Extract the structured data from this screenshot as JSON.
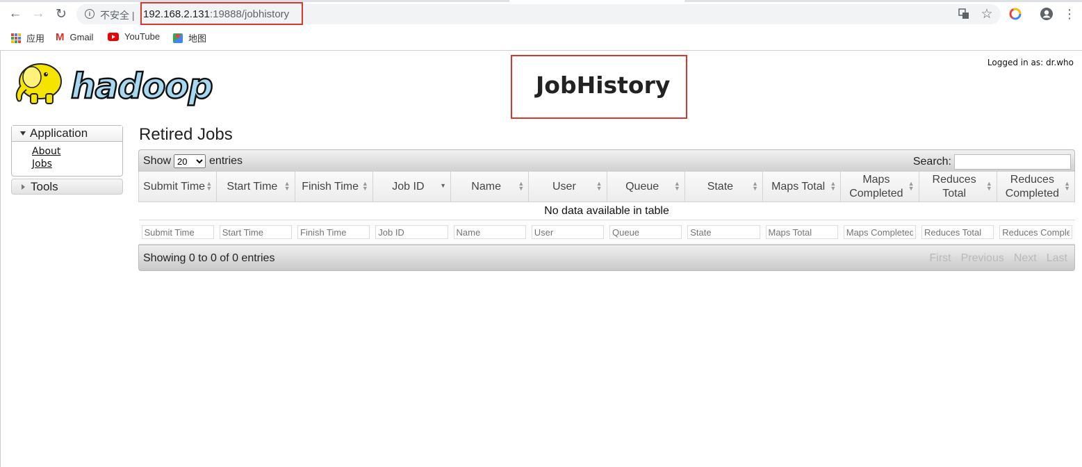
{
  "browser": {
    "insecure_label": "不安全 |",
    "url_host": "192.168.2.131",
    "url_path": ":19888/jobhistory",
    "bookmarks": [
      {
        "label": "应用",
        "icon": "apps-grid-icon"
      },
      {
        "label": "Gmail",
        "icon": "gmail-icon"
      },
      {
        "label": "YouTube",
        "icon": "youtube-icon"
      },
      {
        "label": "地图",
        "icon": "maps-icon"
      }
    ],
    "annotation_color": "#d9372d"
  },
  "header": {
    "logo_text": "hadoop",
    "title": "JobHistory",
    "logged_in": "Logged in as: dr.who"
  },
  "sidebar": {
    "application": {
      "label": "Application",
      "links": [
        "About",
        "Jobs"
      ]
    },
    "tools_label": "Tools"
  },
  "main": {
    "section_title": "Retired Jobs",
    "show_label": "Show",
    "entries_value": "20",
    "entries_label": "entries",
    "search_label": "Search:",
    "columns": [
      {
        "line1": "Submit Time",
        "line2": ""
      },
      {
        "line1": "Start Time",
        "line2": ""
      },
      {
        "line1": "Finish Time",
        "line2": ""
      },
      {
        "line1": "Job ID",
        "line2": ""
      },
      {
        "line1": "Name",
        "line2": ""
      },
      {
        "line1": "User",
        "line2": ""
      },
      {
        "line1": "Queue",
        "line2": ""
      },
      {
        "line1": "State",
        "line2": ""
      },
      {
        "line1": "Maps Total",
        "line2": ""
      },
      {
        "line1": "Maps",
        "line2": "Completed"
      },
      {
        "line1": "Reduces",
        "line2": "Total"
      },
      {
        "line1": "Reduces",
        "line2": "Completed"
      }
    ],
    "empty_message": "No data available in table",
    "filter_placeholders": [
      "Submit Time",
      "Start Time",
      "Finish Time",
      "Job ID",
      "Name",
      "User",
      "Queue",
      "State",
      "Maps Total",
      "Maps Completed",
      "Reduces Total",
      "Reduces Completed"
    ],
    "info_text": "Showing 0 to 0 of 0 entries",
    "pagination": [
      "First",
      "Previous",
      "Next",
      "Last"
    ]
  }
}
